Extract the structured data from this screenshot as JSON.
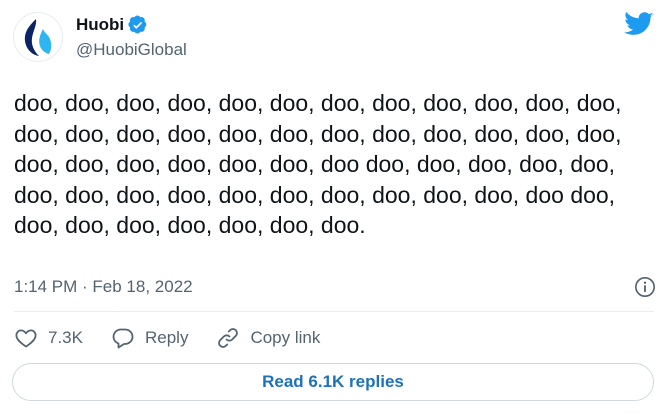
{
  "account": {
    "display_name": "Huobi",
    "handle": "@HuobiGlobal",
    "verified": true
  },
  "tweet": {
    "text": "doo, doo, doo, doo, doo, doo, doo, doo, doo, doo, doo, doo, doo, doo, doo, doo, doo, doo, doo, doo, doo, doo, doo, doo, doo, doo, doo, doo, doo, doo, doo doo, doo, doo, doo, doo, doo, doo, doo, doo, doo, doo, doo, doo, doo, doo, doo doo, doo, doo, doo, doo, doo, doo, doo.",
    "timestamp": "1:14 PM · Feb 18, 2022"
  },
  "actions": {
    "like_count": "7.3K",
    "reply_label": "Reply",
    "copy_link_label": "Copy link"
  },
  "footer": {
    "read_replies_label": "Read 6.1K replies"
  },
  "icons": {
    "brand": "twitter-bird-icon",
    "verified": "verified-badge-icon",
    "info": "info-icon",
    "like": "heart-icon",
    "reply": "reply-bubble-icon",
    "copy_link": "link-icon"
  },
  "colors": {
    "twitter_blue": "#1d9bf0",
    "link_blue": "#1d72b8",
    "text_primary": "#0f1419",
    "text_secondary": "#536471",
    "avatar_navy": "#0a2466",
    "avatar_blue": "#2fb6f0"
  }
}
